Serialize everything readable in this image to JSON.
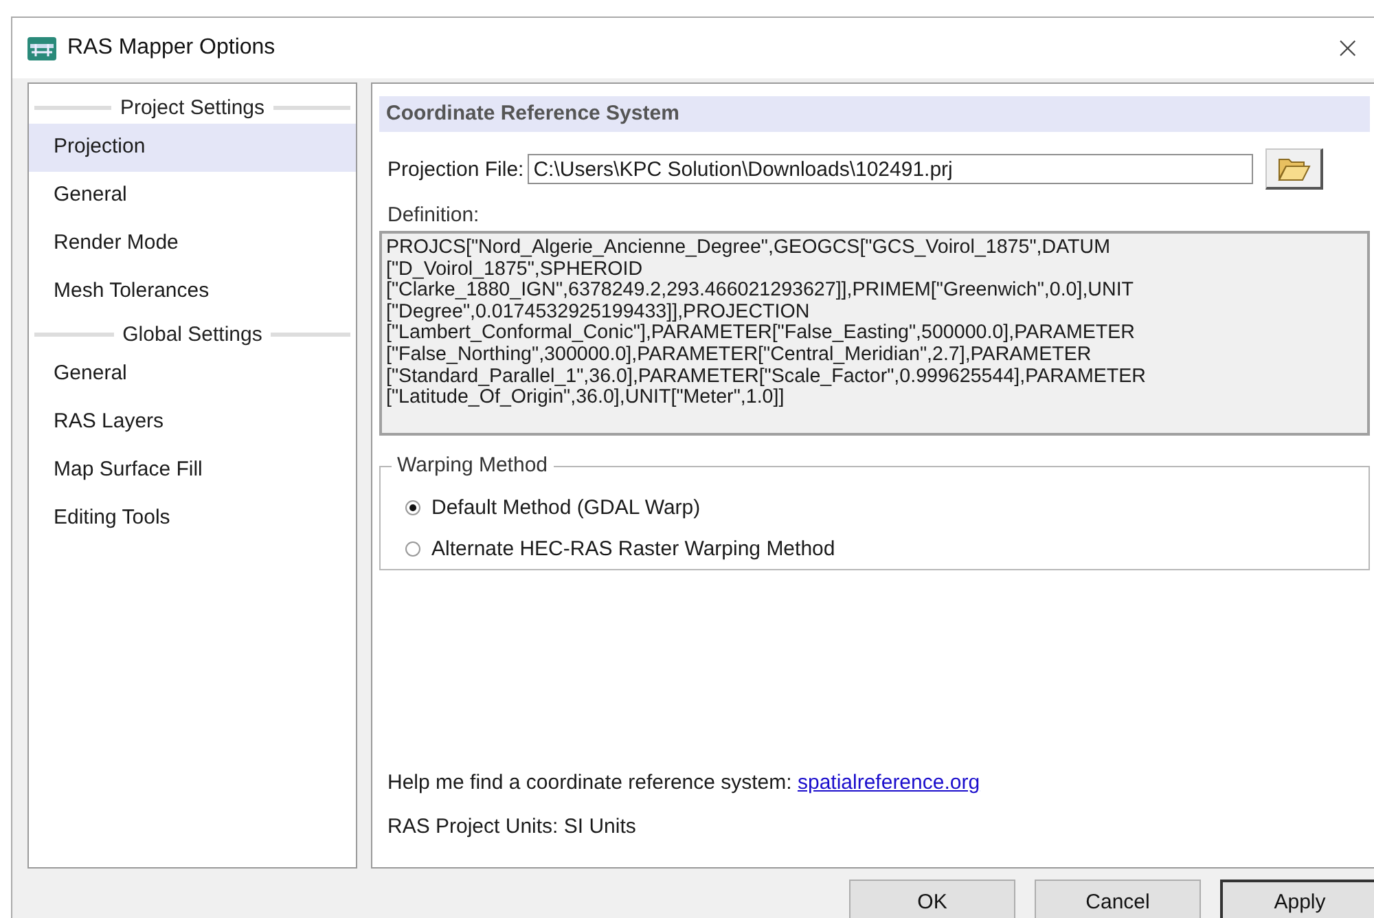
{
  "window": {
    "title": "RAS Mapper Options",
    "close": "×"
  },
  "sidebar": {
    "sections": [
      {
        "header": "Project Settings",
        "items": [
          {
            "label": "Projection",
            "selected": true
          },
          {
            "label": "General",
            "selected": false
          },
          {
            "label": "Render Mode",
            "selected": false
          },
          {
            "label": "Mesh Tolerances",
            "selected": false
          }
        ]
      },
      {
        "header": "Global Settings",
        "items": [
          {
            "label": "General",
            "selected": false
          },
          {
            "label": "RAS Layers",
            "selected": false
          },
          {
            "label": "Map Surface Fill",
            "selected": false
          },
          {
            "label": "Editing Tools",
            "selected": false
          }
        ]
      }
    ]
  },
  "panel": {
    "header": "Coordinate Reference System",
    "projection_file": {
      "label": "Projection File:",
      "value": "C:\\Users\\KPC Solution\\Downloads\\102491.prj"
    },
    "definition": {
      "label": "Definition:",
      "lines": [
        "PROJCS[\"Nord_Algerie_Ancienne_Degree\",GEOGCS[\"GCS_Voirol_1875\",DATUM",
        "[\"D_Voirol_1875\",SPHEROID",
        "[\"Clarke_1880_IGN\",6378249.2,293.466021293627]],PRIMEM[\"Greenwich\",0.0],UNIT",
        "[\"Degree\",0.0174532925199433]],PROJECTION",
        "[\"Lambert_Conformal_Conic\"],PARAMETER[\"False_Easting\",500000.0],PARAMETER",
        "[\"False_Northing\",300000.0],PARAMETER[\"Central_Meridian\",2.7],PARAMETER",
        "[\"Standard_Parallel_1\",36.0],PARAMETER[\"Scale_Factor\",0.999625544],PARAMETER",
        "[\"Latitude_Of_Origin\",36.0],UNIT[\"Meter\",1.0]]"
      ]
    },
    "warping": {
      "title": "Warping Method",
      "options": [
        {
          "label": "Default Method (GDAL Warp)",
          "selected": true
        },
        {
          "label": "Alternate HEC-RAS Raster Warping Method",
          "selected": false
        }
      ]
    },
    "help": {
      "text": "Help me find a coordinate reference system:",
      "link": "spatialreference.org"
    },
    "units": "RAS Project Units: SI Units"
  },
  "buttons": [
    "OK",
    "Cancel",
    "Apply"
  ]
}
